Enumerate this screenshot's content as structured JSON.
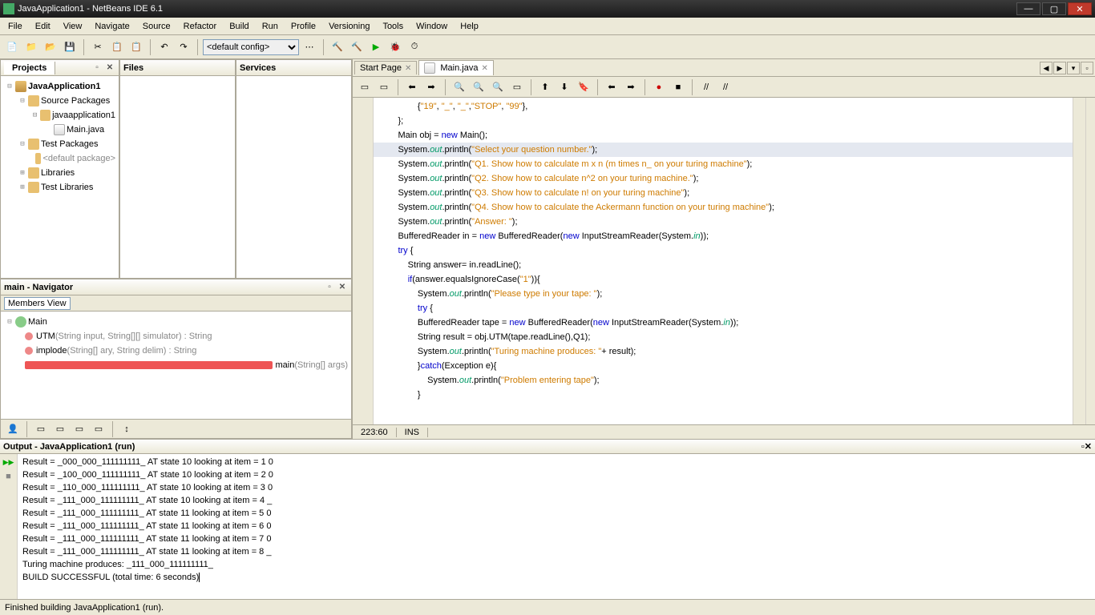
{
  "window": {
    "title": "JavaApplication1 - NetBeans IDE 6.1"
  },
  "menu": [
    "File",
    "Edit",
    "View",
    "Navigate",
    "Source",
    "Refactor",
    "Build",
    "Run",
    "Profile",
    "Versioning",
    "Tools",
    "Window",
    "Help"
  ],
  "config": {
    "value": "<default config>"
  },
  "left_tabs": {
    "projects": "Projects",
    "files": "Files",
    "services": "Services"
  },
  "project_tree": {
    "root": "JavaApplication1",
    "src": "Source Packages",
    "pkg": "javaapplication1",
    "main": "Main.java",
    "test": "Test Packages",
    "defpkg": "<default package>",
    "libs": "Libraries",
    "testlibs": "Test Libraries"
  },
  "navigator": {
    "title": "main - Navigator",
    "view": "Members View",
    "class": "Main",
    "m1_name": "UTM",
    "m1_sig": "(String input, String[][] simulator) : String",
    "m2_name": "implode",
    "m2_sig": "(String[] ary, String delim) : String",
    "m3_name": "main",
    "m3_sig": "(String[] args)"
  },
  "editor_tabs": {
    "start": "Start Page",
    "main": "Main.java"
  },
  "editor_status": {
    "pos": "223:60",
    "mode": "INS"
  },
  "code": {
    "l1a": "                {",
    "l1b": "\"19\"",
    "l1c": ", ",
    "l1d": "\"_\"",
    "l1e": ", ",
    "l1f": "\"_\"",
    "l1g": ",",
    "l1h": "\"STOP\"",
    "l1i": ", ",
    "l1j": "\"99\"",
    "l1k": "},",
    "l2": "        };",
    "l3a": "        Main obj = ",
    "l3b": "new",
    "l3c": " Main();",
    "l4a": "        System.",
    "l4b": "out",
    "l4c": ".println(",
    "l4d": "\"Select your question number.\"",
    "l4e": ");",
    "l5a": "        System.",
    "l5b": "out",
    "l5c": ".println(",
    "l5d": "\"Q1. Show how to calculate m x n (m times n_ on your turing machine\"",
    "l5e": ");",
    "l6a": "        System.",
    "l6b": "out",
    "l6c": ".println(",
    "l6d": "\"Q2. Show how to calculate n^2 on your turing machine.\"",
    "l6e": ");",
    "l7a": "        System.",
    "l7b": "out",
    "l7c": ".println(",
    "l7d": "\"Q3. Show how to calculate n! on your turing machine\"",
    "l7e": ");",
    "l8a": "        System.",
    "l8b": "out",
    "l8c": ".println(",
    "l8d": "\"Q4. Show how to calculate the Ackermann function on your turing machine\"",
    "l8e": ");",
    "l9a": "        System.",
    "l9b": "out",
    "l9c": ".println(",
    "l9d": "\"Answer: \"",
    "l9e": ");",
    "l10a": "        BufferedReader in = ",
    "l10b": "new",
    "l10c": " BufferedReader(",
    "l10d": "new",
    "l10e": " InputStreamReader(System.",
    "l10f": "in",
    "l10g": "));",
    "l11a": "        ",
    "l11b": "try",
    "l11c": " {",
    "l12": "            String answer= in.readLine();",
    "l13a": "            ",
    "l13b": "if",
    "l13c": "(answer.equalsIgnoreCase(",
    "l13d": "\"1\"",
    "l13e": ")){",
    "l14a": "                System.",
    "l14b": "out",
    "l14c": ".println(",
    "l14d": "\"Please type in your tape: \"",
    "l14e": ");",
    "l15a": "                ",
    "l15b": "try",
    "l15c": " {",
    "l16a": "                BufferedReader tape = ",
    "l16b": "new",
    "l16c": " BufferedReader(",
    "l16d": "new",
    "l16e": " InputStreamReader(System.",
    "l16f": "in",
    "l16g": "));",
    "l17": "                String result = obj.UTM(tape.readLine(),Q1);",
    "l18a": "                System.",
    "l18b": "out",
    "l18c": ".println(",
    "l18d": "\"Turing machine produces: \"",
    "l18e": "+ result);",
    "l19a": "                }",
    "l19b": "catch",
    "l19c": "(Exception e){",
    "l20a": "                    System.",
    "l20b": "out",
    "l20c": ".println(",
    "l20d": "\"Problem entering tape\"",
    "l20e": ");",
    "l21": "                }"
  },
  "output": {
    "title": "Output - JavaApplication1 (run)",
    "lines": [
      "Result = _000_000_111111111_ AT state 10 looking at item = 1 0",
      "Result = _100_000_111111111_ AT state 10 looking at item = 2 0",
      "Result = _110_000_111111111_ AT state 10 looking at item = 3 0",
      "Result = _111_000_111111111_ AT state 10 looking at item = 4 _",
      "Result = _111_000_111111111_ AT state 11 looking at item = 5 0",
      "Result = _111_000_111111111_ AT state 11 looking at item = 6 0",
      "Result = _111_000_111111111_ AT state 11 looking at item = 7 0",
      "Result = _111_000_111111111_ AT state 11 looking at item = 8 _",
      "Turing machine produces: _111_000_111111111_",
      "BUILD SUCCESSFUL (total time: 6 seconds)"
    ]
  },
  "status": {
    "text": "Finished building JavaApplication1 (run)."
  }
}
